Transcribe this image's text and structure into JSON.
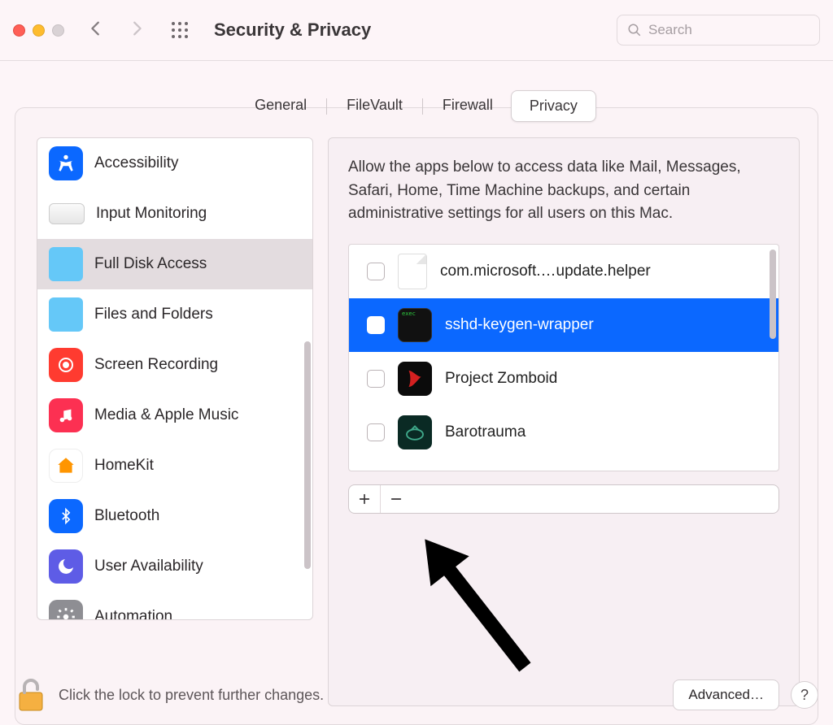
{
  "window": {
    "title": "Security & Privacy"
  },
  "search": {
    "placeholder": "Search"
  },
  "tabs": {
    "general": "General",
    "filevault": "FileVault",
    "firewall": "Firewall",
    "privacy": "Privacy"
  },
  "sidebar": {
    "items": [
      {
        "label": "Accessibility",
        "icon": "accessibility-icon"
      },
      {
        "label": "Input Monitoring",
        "icon": "keyboard-icon"
      },
      {
        "label": "Full Disk Access",
        "icon": "folder-icon",
        "selected": true
      },
      {
        "label": "Files and Folders",
        "icon": "folder-icon"
      },
      {
        "label": "Screen Recording",
        "icon": "screen-recording-icon"
      },
      {
        "label": "Media & Apple Music",
        "icon": "music-icon"
      },
      {
        "label": "HomeKit",
        "icon": "homekit-icon"
      },
      {
        "label": "Bluetooth",
        "icon": "bluetooth-icon"
      },
      {
        "label": "User Availability",
        "icon": "moon-icon"
      },
      {
        "label": "Automation",
        "icon": "gear-icon"
      }
    ]
  },
  "main": {
    "description": "Allow the apps below to access data like Mail, Messages, Safari, Home, Time Machine backups, and certain administrative settings for all users on this Mac.",
    "apps": [
      {
        "name": "com.microsoft.…update.helper",
        "checked": false,
        "icon": "document-icon"
      },
      {
        "name": "sshd-keygen-wrapper",
        "checked": false,
        "selected": true,
        "icon": "terminal-icon"
      },
      {
        "name": "Project Zomboid",
        "checked": false,
        "icon": "pz-icon"
      },
      {
        "name": "Barotrauma",
        "checked": false,
        "icon": "barotrauma-icon"
      }
    ]
  },
  "footer": {
    "lock_text": "Click the lock to prevent further changes.",
    "advanced_label": "Advanced…",
    "help_label": "?"
  }
}
